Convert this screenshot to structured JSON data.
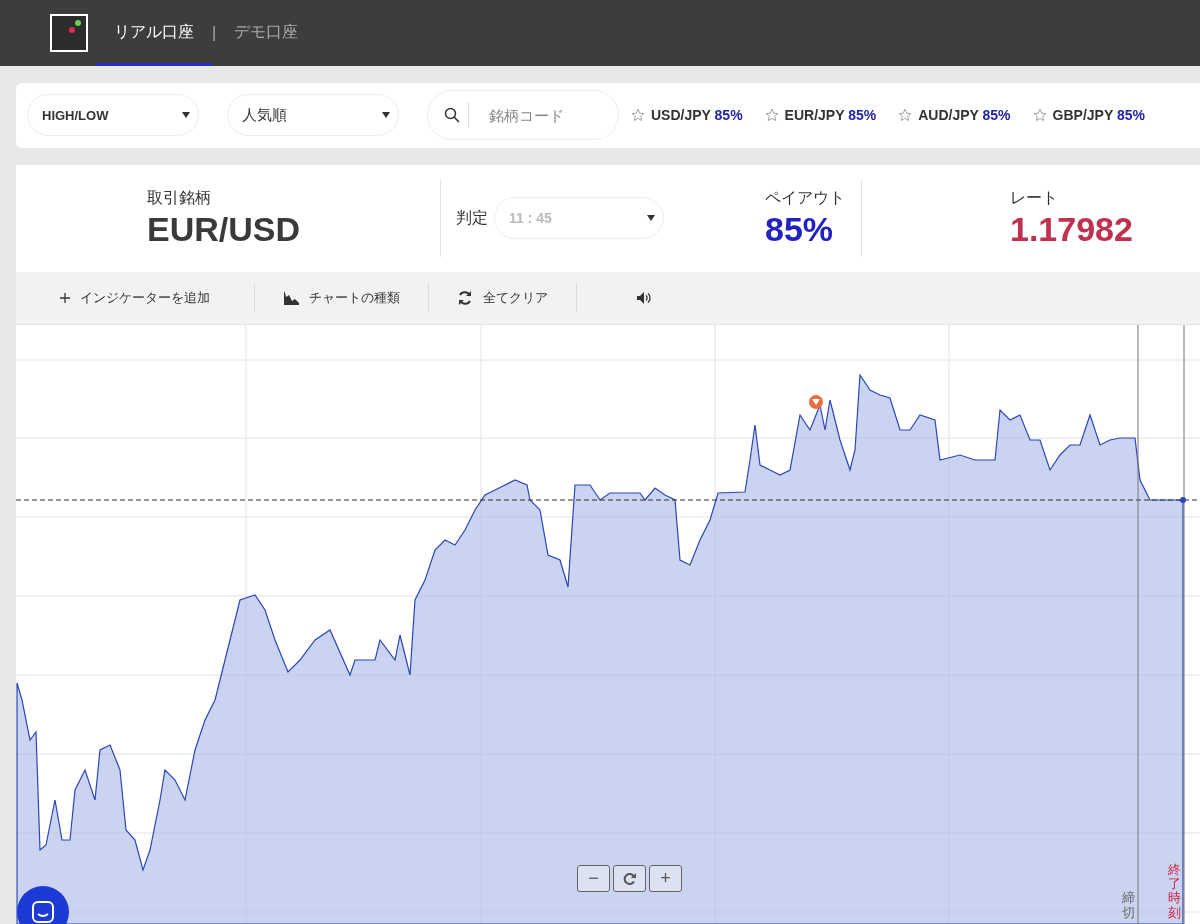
{
  "header": {
    "accounts": [
      {
        "label": "リアル口座",
        "selected": true
      },
      {
        "label": "デモ口座",
        "selected": false
      }
    ],
    "separator": "|"
  },
  "filters": {
    "type_select": "HIGH/LOW",
    "sort_select": "人気順",
    "search": {
      "placeholder": "銘柄コード"
    },
    "favorites": [
      {
        "pair": "USD/JPY",
        "payout": "85%",
        "starred": false
      },
      {
        "pair": "EUR/JPY",
        "payout": "85%",
        "starred": false
      },
      {
        "pair": "AUD/JPY",
        "payout": "85%",
        "starred": false
      },
      {
        "pair": "GBP/JPY",
        "payout": "85%",
        "starred": false
      }
    ]
  },
  "info": {
    "symbol_label": "取引銘柄",
    "symbol": "EUR/USD",
    "expiry_label": "判定",
    "expiry": "11 : 45",
    "expiry_disabled": true,
    "payout_label": "ペイアウト",
    "payout": "85%",
    "rate_label": "レート",
    "rate": "1.17982"
  },
  "toolbar": [
    {
      "kind": "add",
      "label": "インジケーターを追加"
    },
    {
      "kind": "chart_type",
      "label": "チャートの種類"
    },
    {
      "kind": "clear",
      "label": "全てクリア"
    },
    {
      "kind": "sound"
    }
  ],
  "chart": {
    "deadline_label": "締切",
    "end_label": "終了時刻",
    "zoom_out": "−",
    "zoom_in": "+"
  }
}
